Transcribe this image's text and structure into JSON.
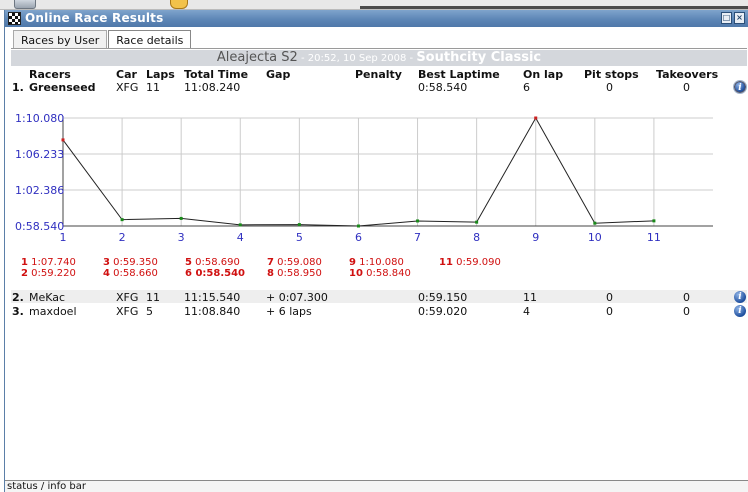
{
  "window": {
    "title": "Online Race Results",
    "max_glyph": "□",
    "close_glyph": "×"
  },
  "tabs": [
    {
      "label": "Races by User",
      "active": false
    },
    {
      "label": "Race details",
      "active": true
    }
  ],
  "race": {
    "car": "Aleajecta S2",
    "when": " - 20:52, 10 Sep 2008 - ",
    "track": "Southcity Classic"
  },
  "columns": {
    "racers": "Racers",
    "car": "Car",
    "laps": "Laps",
    "total_time": "Total Time",
    "gap": "Gap",
    "penalty": "Penalty",
    "best_laptime": "Best Laptime",
    "on_lap": "On lap",
    "pit_stops": "Pit stops",
    "takeovers": "Takeovers"
  },
  "results": [
    {
      "pos": "1.",
      "racer": "Greenseed",
      "car": "XFG",
      "laps": "11",
      "total_time": "11:08.240",
      "gap": "",
      "penalty": "",
      "best_laptime": "0:58.540",
      "on_lap": "6",
      "pit_stops": "0",
      "takeovers": "0"
    },
    {
      "pos": "2.",
      "racer": "MeKac",
      "car": "XFG",
      "laps": "11",
      "total_time": "11:15.540",
      "gap": "+ 0:07.300",
      "penalty": "",
      "best_laptime": "0:59.150",
      "on_lap": "11",
      "pit_stops": "0",
      "takeovers": "0"
    },
    {
      "pos": "3.",
      "racer": "maxdoel",
      "car": "XFG",
      "laps": "5",
      "total_time": "11:08.840",
      "gap": "+ 6 laps",
      "penalty": "",
      "best_laptime": "0:59.020",
      "on_lap": "4",
      "pit_stops": "0",
      "takeovers": "0"
    }
  ],
  "info_glyph": "i",
  "chart_data": {
    "type": "line",
    "x": [
      1,
      2,
      3,
      4,
      5,
      6,
      7,
      8,
      9,
      10,
      11
    ],
    "series": [
      {
        "values": [
          67.74,
          59.22,
          59.35,
          58.66,
          58.69,
          58.54,
          59.08,
          58.95,
          70.08,
          58.84,
          59.09
        ]
      }
    ],
    "y_ticks": [
      {
        "value": 58.54,
        "label": "0:58.540"
      },
      {
        "value": 62.386,
        "label": "1:02.386"
      },
      {
        "value": 66.233,
        "label": "1:06.233"
      },
      {
        "value": 70.08,
        "label": "1:10.080"
      }
    ],
    "xlim": [
      1,
      12
    ],
    "ylim": [
      58.54,
      70.08
    ],
    "grid": true,
    "line_color": "#222222",
    "point_color": "#1a8a1a",
    "extreme_point_color": "#cc2020",
    "grid_color": "#cccccc",
    "axis_label_color": "#3030c0"
  },
  "lap_times": [
    {
      "lap": "1",
      "time": "1:07.740",
      "best": false
    },
    {
      "lap": "2",
      "time": "0:59.220",
      "best": false
    },
    {
      "lap": "3",
      "time": "0:59.350",
      "best": false
    },
    {
      "lap": "4",
      "time": "0:58.660",
      "best": false
    },
    {
      "lap": "5",
      "time": "0:58.690",
      "best": false
    },
    {
      "lap": "6",
      "time": "0:58.540",
      "best": true
    },
    {
      "lap": "7",
      "time": "0:59.080",
      "best": false
    },
    {
      "lap": "8",
      "time": "0:58.950",
      "best": false
    },
    {
      "lap": "9",
      "time": "1:10.080",
      "best": false
    },
    {
      "lap": "10",
      "time": "0:58.840",
      "best": false
    },
    {
      "lap": "11",
      "time": "0:59.090",
      "best": false
    }
  ],
  "statusbar": {
    "text": "status / info bar"
  },
  "colors": {
    "title_bar": "#5d86b6",
    "header_band": "#d4d7dc",
    "lap_text": "#d01010"
  }
}
